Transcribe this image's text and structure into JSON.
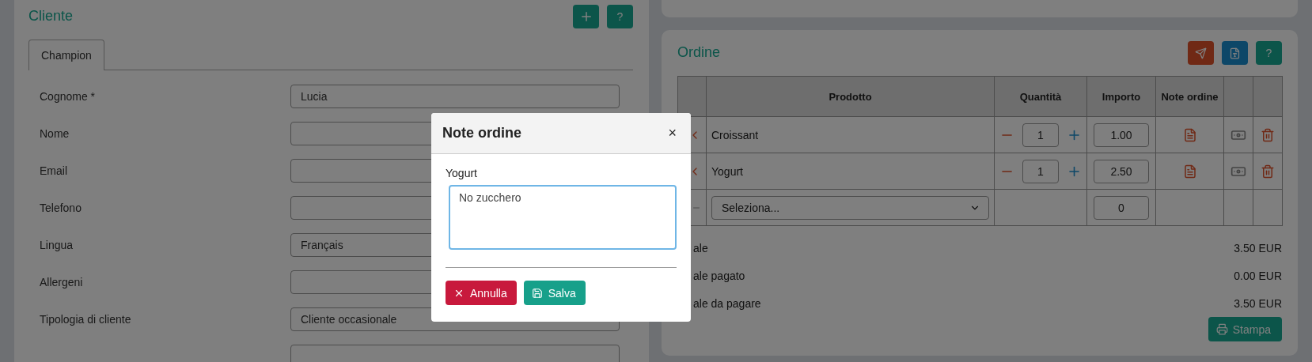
{
  "cliente": {
    "title": "Cliente",
    "help_button": "?",
    "tabs": [
      {
        "label": "Champion",
        "selected": true
      }
    ],
    "fields": [
      {
        "kind": "text",
        "label": "Cognome",
        "required_mark": "*",
        "value": "Lucia"
      },
      {
        "kind": "text",
        "label": "Nome"
      },
      {
        "kind": "text",
        "label": "Email"
      },
      {
        "kind": "text",
        "label": "Telefono"
      },
      {
        "kind": "select",
        "label": "Lingua",
        "value": "Français"
      },
      {
        "kind": "text",
        "label": "Allergeni"
      },
      {
        "kind": "select",
        "label": "Tipologia di cliente",
        "value": "Cliente occasionale"
      },
      {
        "kind": "text"
      }
    ]
  },
  "ordine": {
    "title": "Ordine",
    "help_button": "?",
    "columns": [
      "Prodotto",
      "Quantità",
      "Importo",
      "Note ordine"
    ],
    "rows": [
      {
        "product": "Croissant",
        "quantity": "1",
        "amount": "1.00"
      },
      {
        "product": "Yogurt",
        "quantity": "1",
        "amount": "2.50"
      }
    ],
    "new_row": {
      "product_select": "Seleziona...",
      "amount": "0"
    },
    "totals": [
      {
        "label": "ale",
        "value": "3.50 EUR"
      },
      {
        "label": "ale pagato",
        "value": "0.00 EUR"
      },
      {
        "label": "ale da pagare",
        "value": "3.50 EUR"
      }
    ],
    "print_button": "Stampa"
  },
  "modal": {
    "title": "Note ordine",
    "close": "×",
    "product": "Yogurt",
    "note": "No zucchero",
    "cancel": "Annulla",
    "save": "Salva"
  }
}
